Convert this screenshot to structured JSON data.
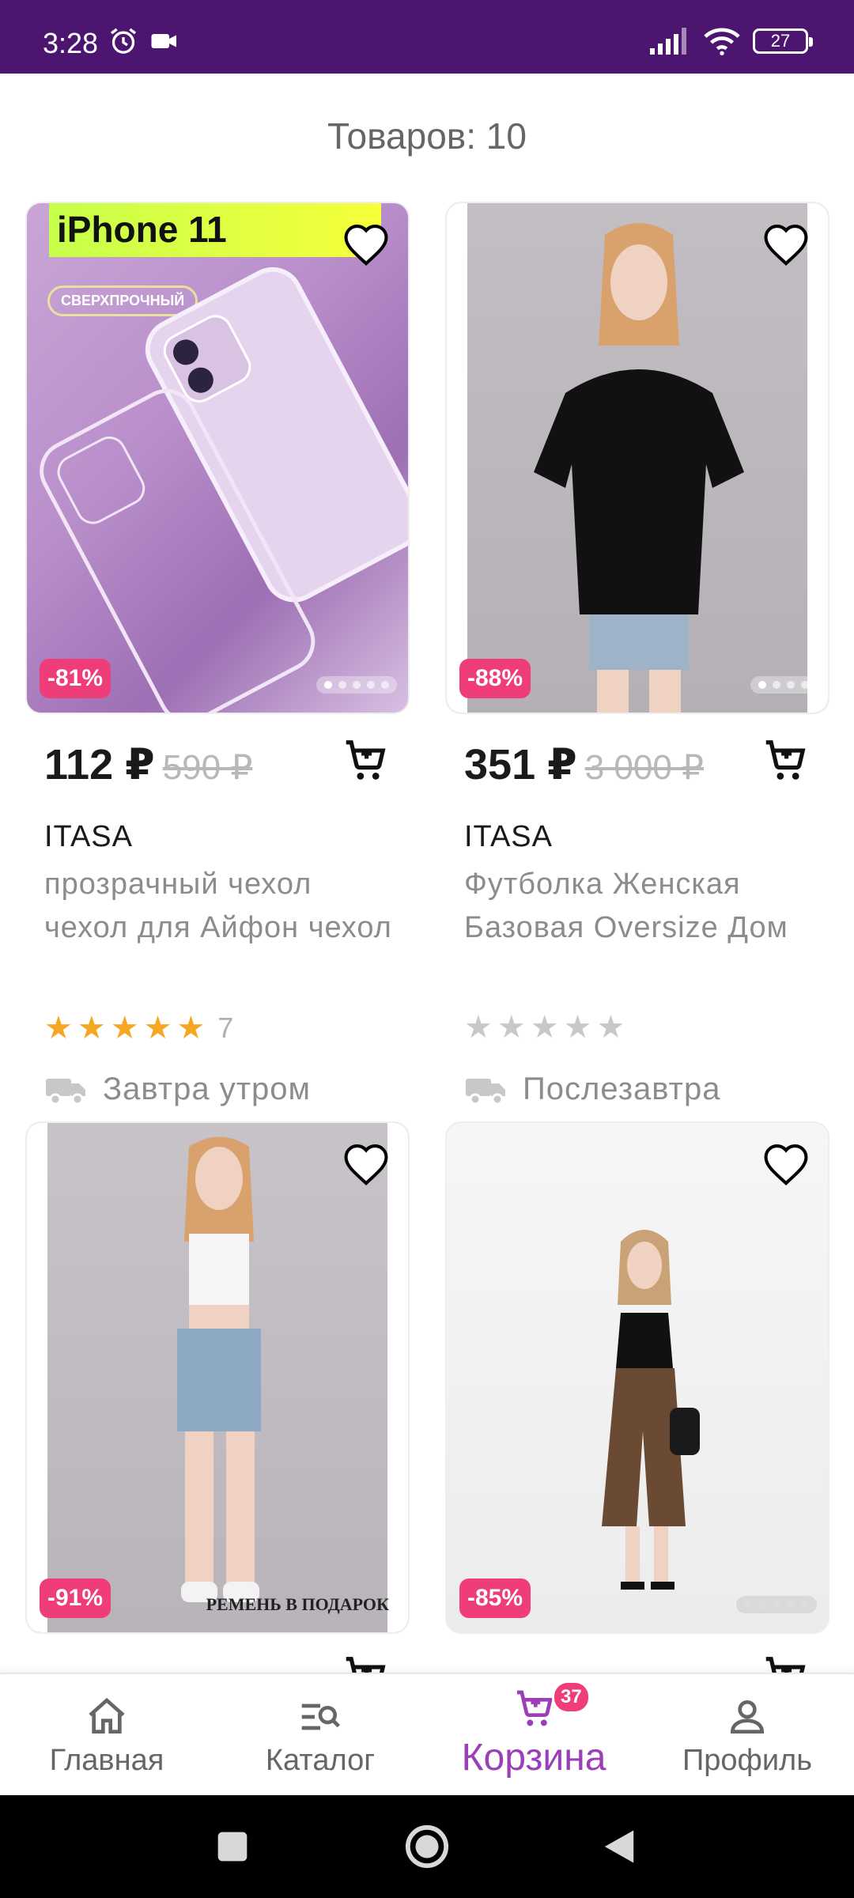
{
  "status_bar": {
    "time": "3:28",
    "battery": "27"
  },
  "count_label": "Товаров: 10",
  "products": [
    {
      "image_text_top": "iPhone 11",
      "image_text_tag": "СВЕРХПРОЧНЫЙ",
      "discount": "-81%",
      "price": "112 ₽",
      "old_price": "590 ₽",
      "brand": "ITASA",
      "title_line1": "прозрачный чехол",
      "title_line2": "чехол для Айфон чехол",
      "rating_count": "7",
      "rating": 5,
      "delivery": "Завтра утром"
    },
    {
      "discount": "-88%",
      "price": "351 ₽",
      "old_price": "3 000 ₽",
      "brand": "ITASA",
      "title_line1": "Футболка Женская",
      "title_line2": "Базовая Oversize Дом",
      "rating": 0,
      "delivery": "Послезавтра"
    },
    {
      "discount": "-91%",
      "image_text_bottom": "РЕМЕНЬ В ПОДАРОК"
    },
    {
      "discount": "-85%"
    }
  ],
  "nav": {
    "home": "Главная",
    "catalog": "Каталог",
    "cart": "Корзина",
    "cart_badge": "37",
    "profile": "Профиль"
  },
  "colors": {
    "accent": "#9b3fb8",
    "status_bar": "#4c1570",
    "discount": "#ee3d79",
    "star_filled": "#f5a623"
  }
}
